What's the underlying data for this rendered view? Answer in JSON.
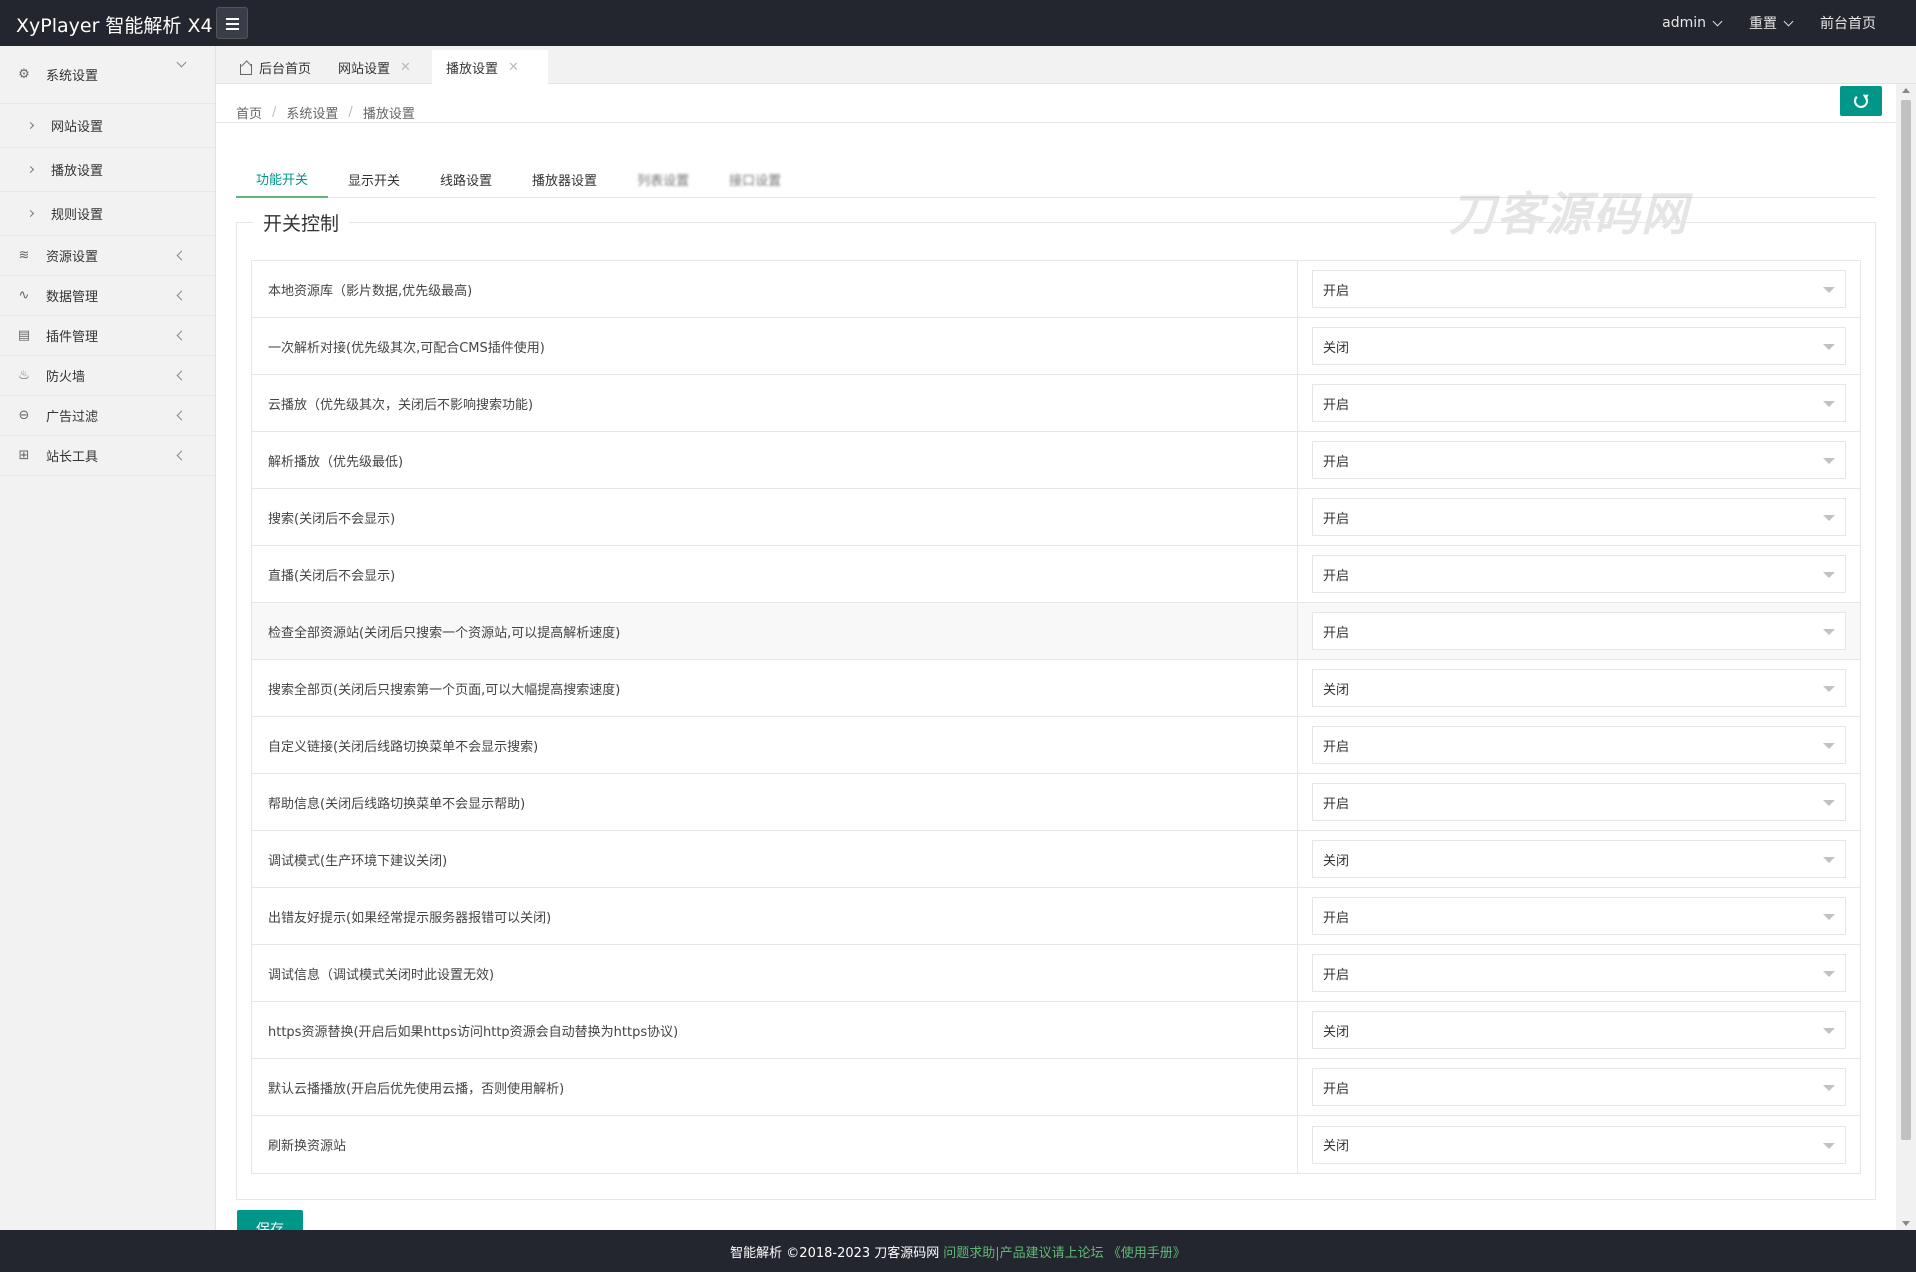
{
  "header": {
    "logo": "XyPlayer 智能解析 X4",
    "user": "admin",
    "reset": "重置",
    "front": "前台首页"
  },
  "sidebar": {
    "groups": [
      {
        "label": "系统设置",
        "icon": "gear-icon",
        "expanded": true,
        "subs": [
          "网站设置",
          "播放设置",
          "规则设置"
        ]
      },
      {
        "label": "资源设置",
        "icon": "rss-icon"
      },
      {
        "label": "数据管理",
        "icon": "pulse-icon"
      },
      {
        "label": "插件管理",
        "icon": "plugin-icon"
      },
      {
        "label": "防火墙",
        "icon": "fire-icon"
      },
      {
        "label": "广告过滤",
        "icon": "minus-circle-icon"
      },
      {
        "label": "站长工具",
        "icon": "app-grid-icon"
      }
    ]
  },
  "tabs": [
    {
      "label": "后台首页",
      "closable": false
    },
    {
      "label": "网站设置",
      "closable": true
    },
    {
      "label": "播放设置",
      "closable": true,
      "active": true
    }
  ],
  "breadcrumb": [
    "首页",
    "系统设置",
    "播放设置"
  ],
  "form_tabs": [
    "功能开关",
    "显示开关",
    "线路设置",
    "播放器设置",
    "列表设置",
    "接口设置"
  ],
  "watermark": "刀客源码网",
  "legend": "开关控制",
  "rows": [
    {
      "label": "本地资源库（影片数据,优先级最高)",
      "value": "开启"
    },
    {
      "label": "一次解析对接(优先级其次,可配合CMS插件使用)",
      "value": "关闭"
    },
    {
      "label": "云播放（优先级其次，关闭后不影响搜索功能)",
      "value": "开启"
    },
    {
      "label": "解析播放（优先级最低)",
      "value": "开启"
    },
    {
      "label": "搜索(关闭后不会显示)",
      "value": "开启"
    },
    {
      "label": "直播(关闭后不会显示)",
      "value": "开启"
    },
    {
      "label": "检查全部资源站(关闭后只搜索一个资源站,可以提高解析速度)",
      "value": "开启"
    },
    {
      "label": "搜索全部页(关闭后只搜索第一个页面,可以大幅提高搜索速度)",
      "value": "关闭"
    },
    {
      "label": "自定义链接(关闭后线路切换菜单不会显示搜索)",
      "value": "开启"
    },
    {
      "label": "帮助信息(关闭后线路切换菜单不会显示帮助)",
      "value": "开启"
    },
    {
      "label": "调试模式(生产环境下建议关闭)",
      "value": "关闭"
    },
    {
      "label": "出错友好提示(如果经常提示服务器报错可以关闭)",
      "value": "开启"
    },
    {
      "label": "调试信息（调试模式关闭时此设置无效)",
      "value": "开启"
    },
    {
      "label": "https资源替换(开启后如果https访问http资源会自动替换为https协议)",
      "value": "关闭"
    },
    {
      "label": "默认云播播放(开启后优先使用云播，否则使用解析)",
      "value": "开启"
    },
    {
      "label": "刷新换资源站",
      "value": "关闭"
    }
  ],
  "save_label": "保存",
  "footer": {
    "text": "智能解析 ©2018-2023 刀客源码网",
    "link": "问题求助|产品建议请上论坛 《使用手册》"
  },
  "colors": {
    "accent": "#009688",
    "header": "#23262e",
    "tab_underline": "#5fb878"
  }
}
